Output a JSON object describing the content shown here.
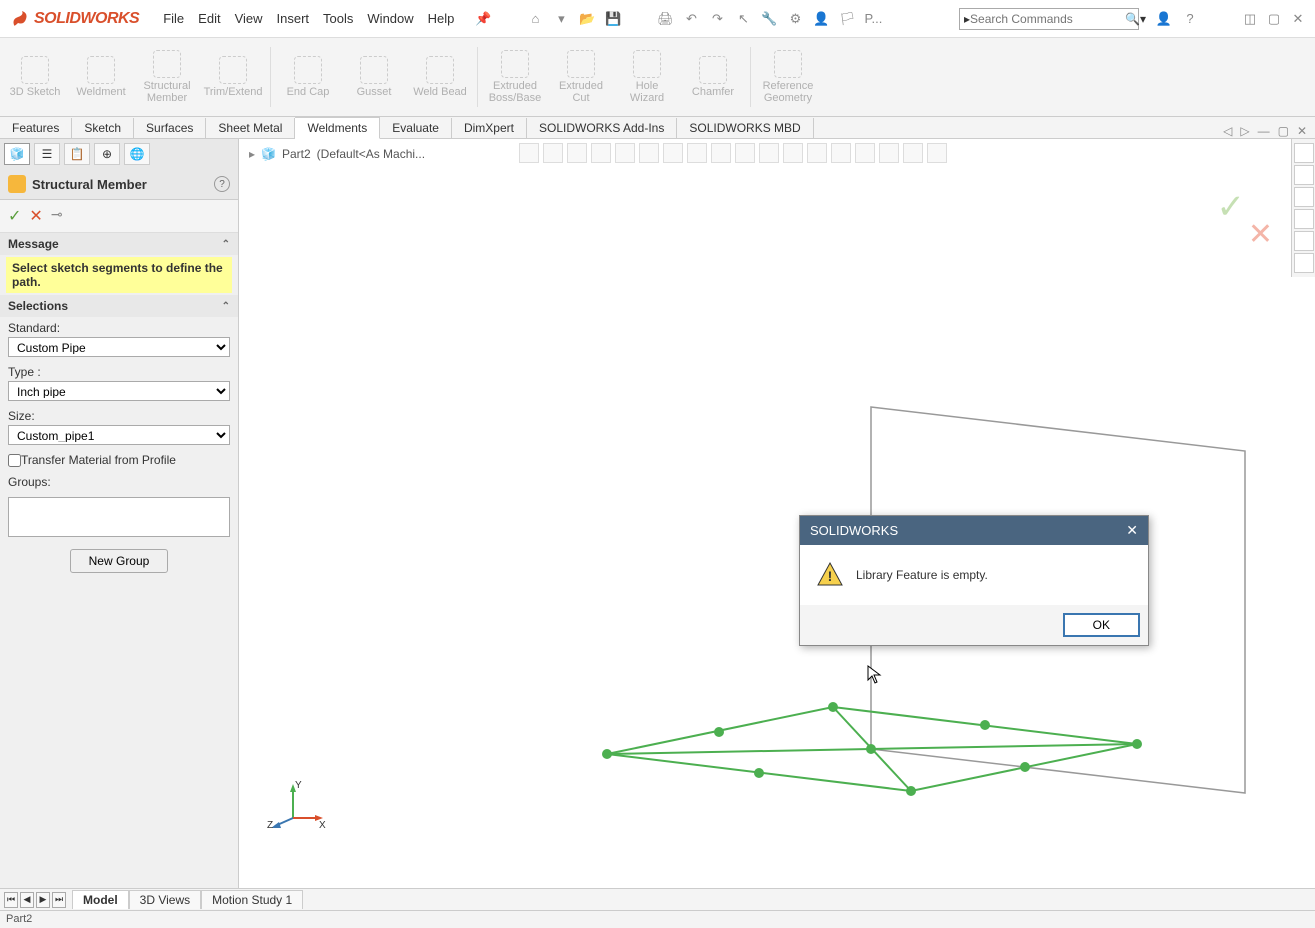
{
  "app": {
    "name": "SOLIDWORKS"
  },
  "menus": [
    "File",
    "Edit",
    "View",
    "Insert",
    "Tools",
    "Window",
    "Help"
  ],
  "search": {
    "placeholder": "Search Commands"
  },
  "ribbon": [
    {
      "label": "3D Sketch"
    },
    {
      "label": "Weldment"
    },
    {
      "label": "Structural Member"
    },
    {
      "label": "Trim/Extend"
    },
    {
      "label": "End Cap"
    },
    {
      "label": "Gusset"
    },
    {
      "label": "Weld Bead"
    },
    {
      "label": "Extruded Boss/Base"
    },
    {
      "label": "Extruded Cut"
    },
    {
      "label": "Hole Wizard"
    },
    {
      "label": "Chamfer"
    },
    {
      "label": "Reference Geometry"
    }
  ],
  "cmd_tabs": [
    "Features",
    "Sketch",
    "Surfaces",
    "Sheet Metal",
    "Weldments",
    "Evaluate",
    "DimXpert",
    "SOLIDWORKS Add-Ins",
    "SOLIDWORKS MBD"
  ],
  "cmd_active": 4,
  "breadcrumb": {
    "part": "Part2",
    "config": "(Default<As Machi..."
  },
  "panel": {
    "title": "Structural Member",
    "message_header": "Message",
    "message_text": "Select sketch segments to define the path.",
    "selections_header": "Selections",
    "standard_label": "Standard:",
    "standard_value": "Custom Pipe",
    "type_label": "Type :",
    "type_value": "Inch pipe",
    "size_label": "Size:",
    "size_value": "Custom_pipe1",
    "transfer_label": "Transfer Material from Profile",
    "groups_label": "Groups:",
    "new_group": "New Group"
  },
  "dialog": {
    "title": "SOLIDWORKS",
    "message": "Library Feature is empty.",
    "ok": "OK"
  },
  "bottom_tabs": [
    "Model",
    "3D Views",
    "Motion Study 1"
  ],
  "bottom_active": 0,
  "status": "Part2",
  "p_label": "P...",
  "colors": {
    "brand": "#d94f2b",
    "dialog_title_bg": "#4a6580",
    "highlight": "#ffff99",
    "sketch_green": "#4caf50"
  }
}
